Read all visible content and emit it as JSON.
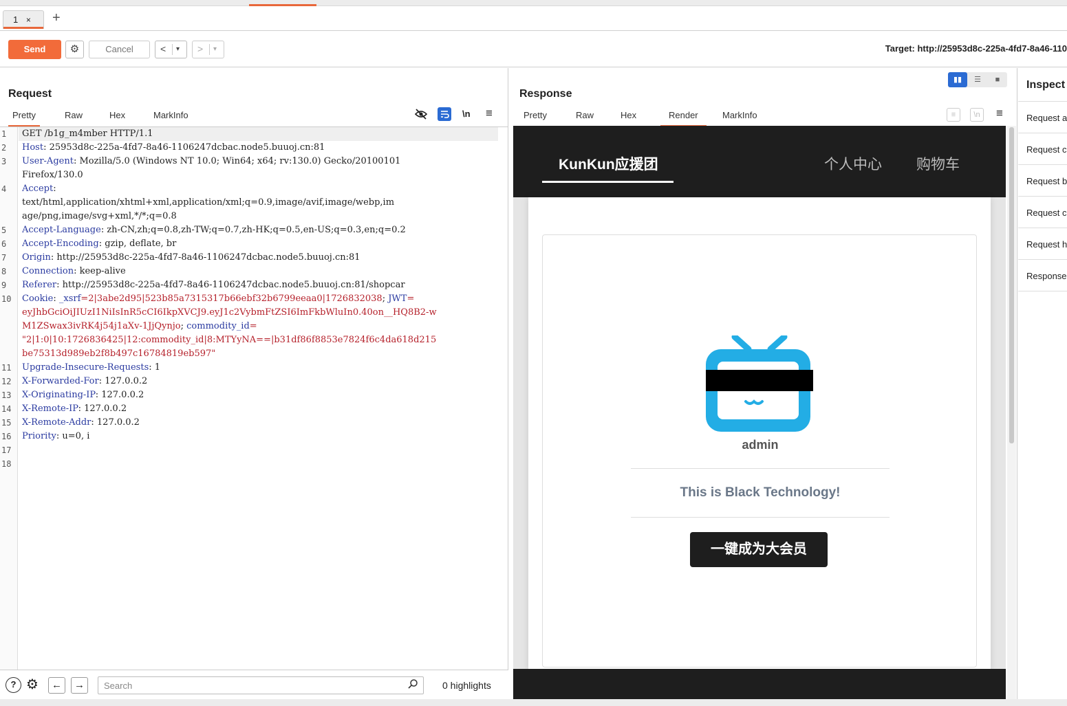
{
  "tabs": [
    {
      "label": "1",
      "close": "×"
    }
  ],
  "add_tab": "+",
  "toolbar": {
    "send_label": "Send",
    "cancel_label": "Cancel",
    "back_glyph": "<",
    "fwd_glyph": ">",
    "dropdown_glyph": "▾",
    "target": "Target: http://25953d8c-225a-4fd7-8a46-110"
  },
  "request": {
    "title": "Request",
    "tabs": [
      "Pretty",
      "Raw",
      "Hex",
      "MarkInfo"
    ],
    "active_tab": "Pretty",
    "newline_toggle": "\\n",
    "lines": [
      {
        "n": "1",
        "parts": [
          {
            "t": "GET /b1g_m4mber HTTP/1.1",
            "c": "hv"
          }
        ]
      },
      {
        "n": "2",
        "parts": [
          {
            "t": "Host",
            "c": "hk"
          },
          {
            "t": ": 25953d8c-225a-4fd7-8a46-1106247dcbac.node5.buuoj.cn:81",
            "c": "hv"
          }
        ]
      },
      {
        "n": "3",
        "parts": [
          {
            "t": "User-Agent",
            "c": "hk"
          },
          {
            "t": ": Mozilla/5.0 (Windows NT 10.0; Win64; x64; rv:130.0) Gecko/20100101",
            "c": "hv"
          }
        ]
      },
      {
        "n": "",
        "parts": [
          {
            "t": " Firefox/130.0",
            "c": "hv"
          }
        ]
      },
      {
        "n": "4",
        "parts": [
          {
            "t": "Accept",
            "c": "hk"
          },
          {
            "t": ":",
            "c": "hv"
          }
        ]
      },
      {
        "n": "",
        "parts": [
          {
            "t": "text/html,application/xhtml+xml,application/xml;q=0.9,image/avif,image/webp,im",
            "c": "hv"
          }
        ]
      },
      {
        "n": "",
        "parts": [
          {
            "t": "age/png,image/svg+xml,*/*;q=0.8",
            "c": "hv"
          }
        ]
      },
      {
        "n": "5",
        "parts": [
          {
            "t": "Accept-Language",
            "c": "hk"
          },
          {
            "t": ": zh-CN,zh;q=0.8,zh-TW;q=0.7,zh-HK;q=0.5,en-US;q=0.3,en;q=0.2",
            "c": "hv"
          }
        ]
      },
      {
        "n": "6",
        "parts": [
          {
            "t": "Accept-Encoding",
            "c": "hk"
          },
          {
            "t": ": gzip, deflate, br",
            "c": "hv"
          }
        ]
      },
      {
        "n": "7",
        "parts": [
          {
            "t": "Origin",
            "c": "hk"
          },
          {
            "t": ": http://25953d8c-225a-4fd7-8a46-1106247dcbac.node5.buuoj.cn:81",
            "c": "hv"
          }
        ]
      },
      {
        "n": "8",
        "parts": [
          {
            "t": "Connection",
            "c": "hk"
          },
          {
            "t": ": keep-alive",
            "c": "hv"
          }
        ]
      },
      {
        "n": "9",
        "parts": [
          {
            "t": "Referer",
            "c": "hk"
          },
          {
            "t": ": http://25953d8c-225a-4fd7-8a46-1106247dcbac.node5.buuoj.cn:81/shopcar",
            "c": "hv"
          }
        ]
      },
      {
        "n": "10",
        "parts": [
          {
            "t": "Cookie",
            "c": "hk"
          },
          {
            "t": ": ",
            "c": "hv"
          },
          {
            "t": "_xsrf",
            "c": "hk"
          },
          {
            "t": "=2|3abe2d95|523b85a7315317b66ebf32b6799eeaa0|1726832038",
            "c": "rv"
          },
          {
            "t": "; ",
            "c": "hv"
          },
          {
            "t": "JWT",
            "c": "hk"
          },
          {
            "t": "=",
            "c": "rv"
          }
        ]
      },
      {
        "n": "",
        "parts": [
          {
            "t": "eyJhbGciOiJIUzI1NiIsInR5cCI6IkpXVCJ9.eyJ1c2VybmFtZSI6ImFkbWluIn0.40on__HQ8B2-w",
            "c": "rv"
          }
        ]
      },
      {
        "n": "",
        "parts": [
          {
            "t": "M1ZSwax3ivRK4j54j1aXv-1JjQynjo",
            "c": "rv"
          },
          {
            "t": "; ",
            "c": "hv"
          },
          {
            "t": "commodity_id",
            "c": "hk"
          },
          {
            "t": "=",
            "c": "rv"
          }
        ]
      },
      {
        "n": "",
        "parts": [
          {
            "t": "\"2|1:0|10:1726836425|12:commodity_id|8:MTYyNA==|b31df86f8853e7824f6c4da618d215",
            "c": "rv"
          }
        ]
      },
      {
        "n": "",
        "parts": [
          {
            "t": "be75313d989eb2f8b497c16784819eb597\"",
            "c": "rv"
          }
        ]
      },
      {
        "n": "11",
        "parts": [
          {
            "t": "Upgrade-Insecure-Requests",
            "c": "hk"
          },
          {
            "t": ": 1",
            "c": "hv"
          }
        ]
      },
      {
        "n": "12",
        "parts": [
          {
            "t": "X-Forwarded-For",
            "c": "hk"
          },
          {
            "t": ": 127.0.0.2",
            "c": "hv"
          }
        ]
      },
      {
        "n": "13",
        "parts": [
          {
            "t": "X-Originating-IP",
            "c": "hk"
          },
          {
            "t": ": 127.0.0.2",
            "c": "hv"
          }
        ]
      },
      {
        "n": "14",
        "parts": [
          {
            "t": "X-Remote-IP",
            "c": "hk"
          },
          {
            "t": ": 127.0.0.2",
            "c": "hv"
          }
        ]
      },
      {
        "n": "15",
        "parts": [
          {
            "t": "X-Remote-Addr",
            "c": "hk"
          },
          {
            "t": ": 127.0.0.2",
            "c": "hv"
          }
        ]
      },
      {
        "n": "16",
        "parts": [
          {
            "t": "Priority",
            "c": "hk"
          },
          {
            "t": ": u=0, i",
            "c": "hv"
          }
        ]
      },
      {
        "n": "17",
        "parts": []
      },
      {
        "n": "18",
        "parts": []
      }
    ],
    "search_placeholder": "Search",
    "highlights": "0 highlights"
  },
  "response": {
    "title": "Response",
    "tabs": [
      "Pretty",
      "Raw",
      "Hex",
      "Render",
      "MarkInfo"
    ],
    "active_tab": "Render",
    "newline_toggle": "\\n",
    "render": {
      "brand": "KunKun应援团",
      "nav_links": [
        "个人中心",
        "购物车"
      ],
      "username": "admin",
      "slogan": "This is Black Technology!",
      "button": "一键成为大会员",
      "avatar_color": "#23ade5"
    }
  },
  "inspector": {
    "title": "Inspect",
    "items": [
      "Request a",
      "Request c",
      "Request b",
      "Request c",
      "Request h",
      "Response"
    ]
  },
  "colors": {
    "accent": "#f26b3a",
    "toggle_blue": "#2b6bd3"
  }
}
